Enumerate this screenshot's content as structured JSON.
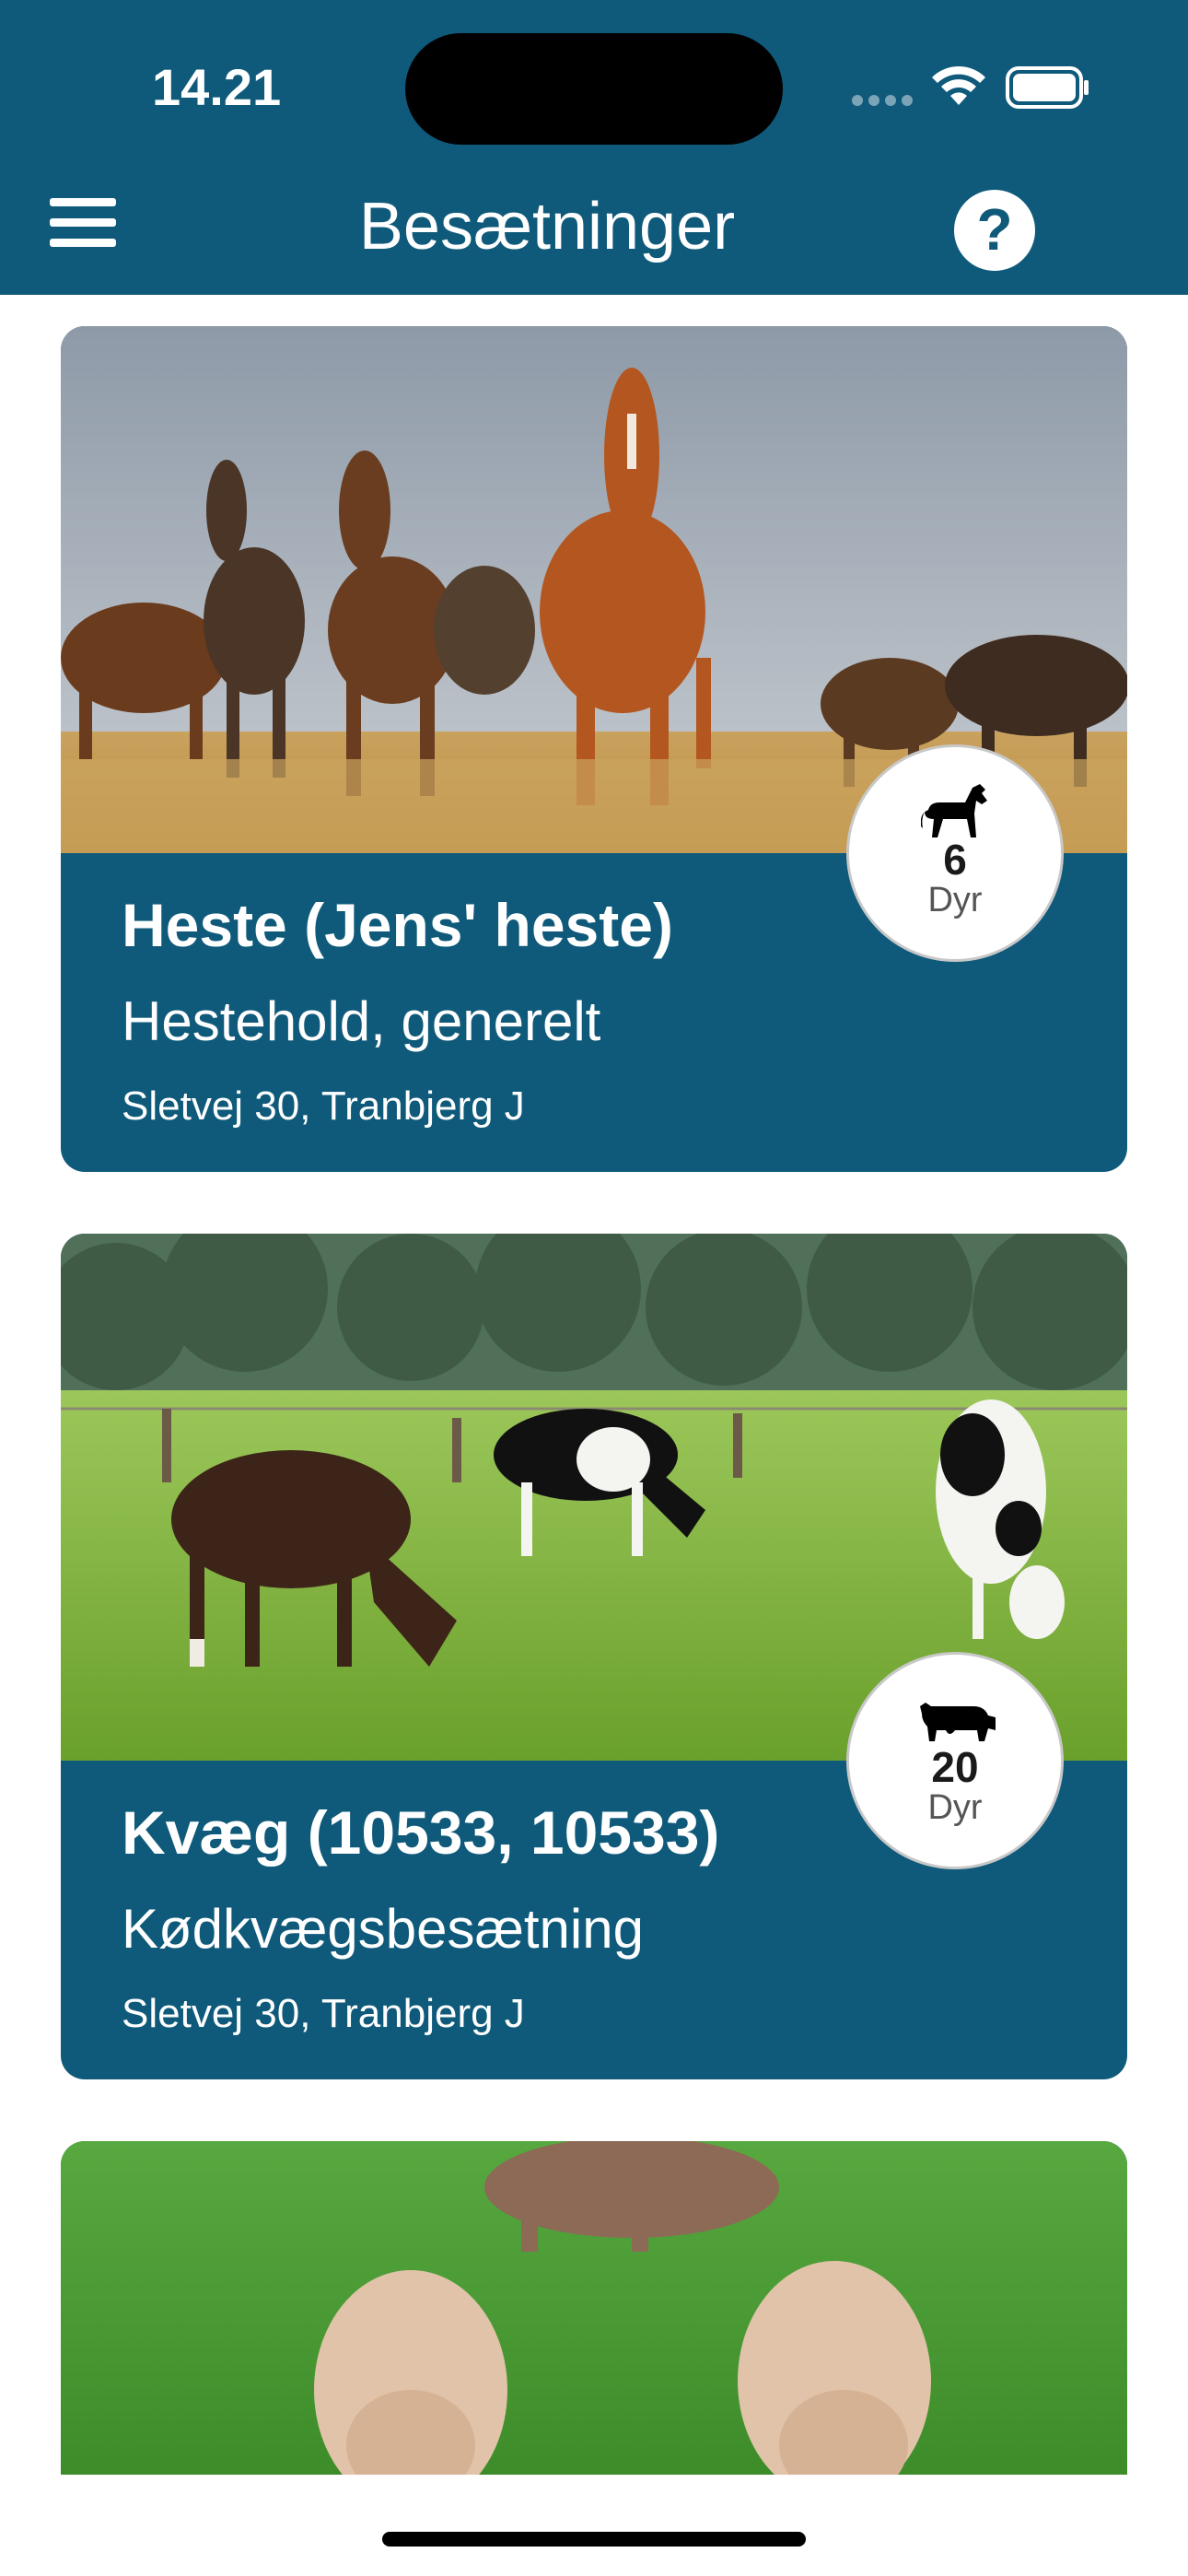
{
  "status_bar": {
    "time": "14.21"
  },
  "header": {
    "title": "Besætninger"
  },
  "herds": [
    {
      "title": "Heste (Jens' heste)",
      "type": "Hestehold, generelt",
      "address": "Sletvej 30, Tranbjerg J",
      "count": "6",
      "unit": "Dyr",
      "icon": "horse-icon",
      "photo": "horses-in-field"
    },
    {
      "title": "Kvæg (10533, 10533)",
      "type": "Kødkvægsbesætning",
      "address": "Sletvej 30, Tranbjerg J",
      "count": "20",
      "unit": "Dyr",
      "icon": "cow-icon",
      "photo": "cows-grazing"
    },
    {
      "photo": "pigs-on-grass"
    }
  ],
  "colors": {
    "header": "#0f5a7a",
    "card": "#0f5a7a"
  }
}
